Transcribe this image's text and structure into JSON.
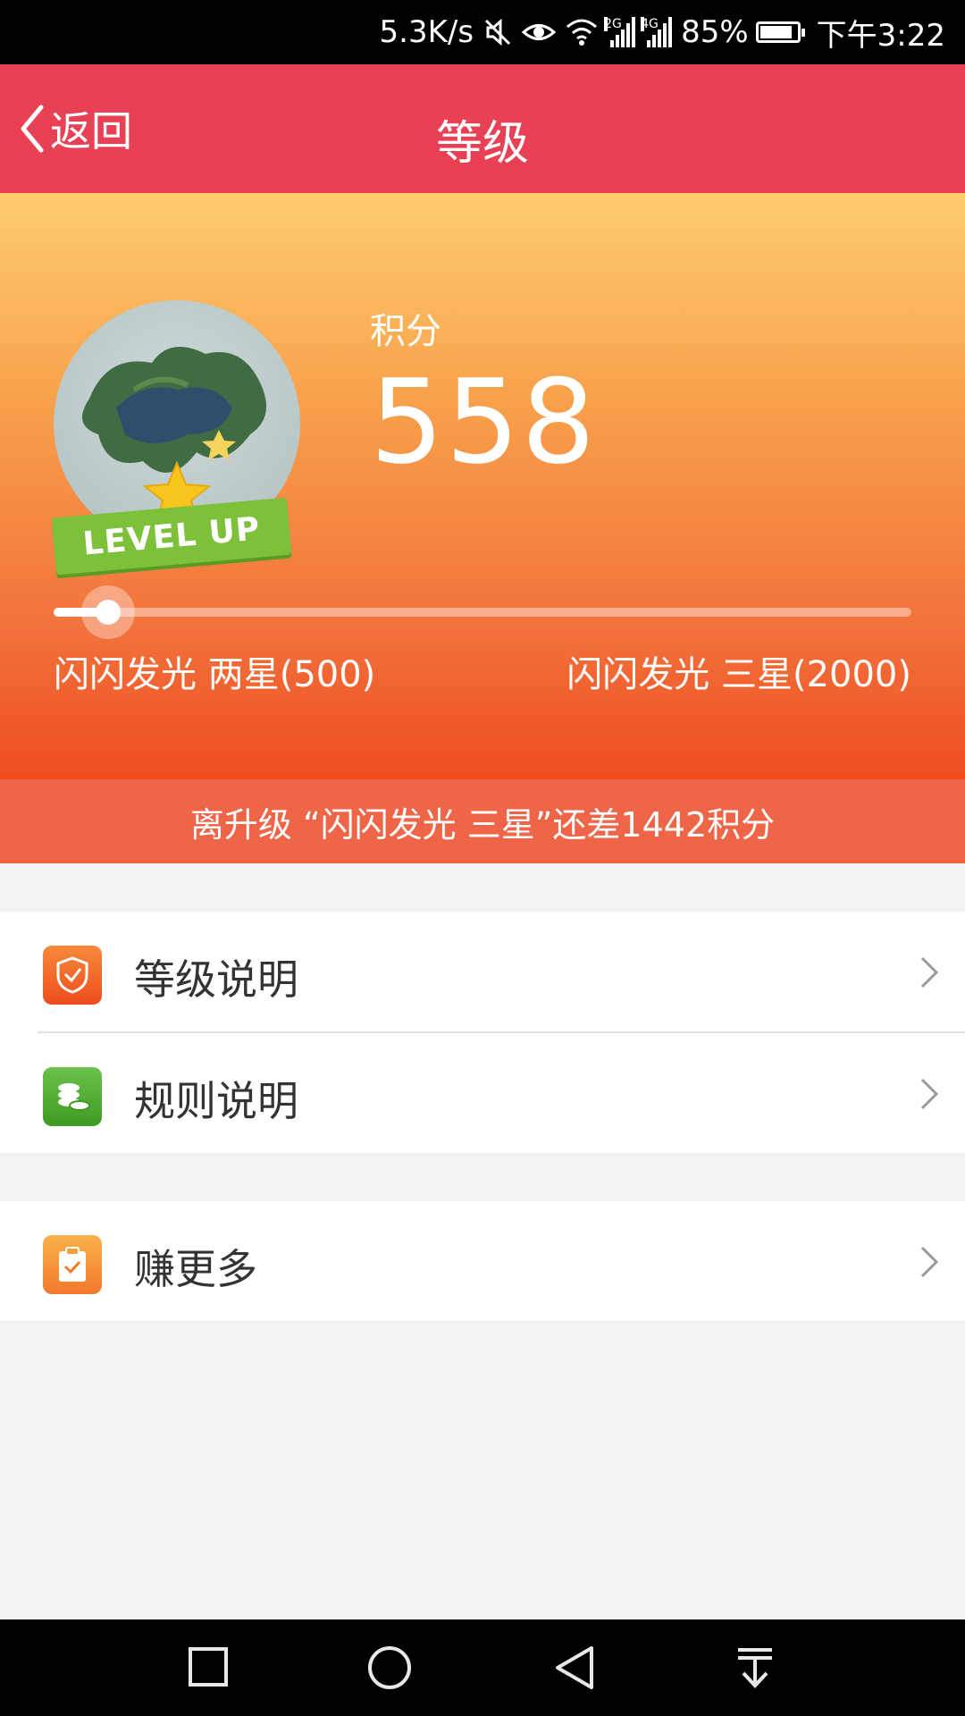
{
  "status_bar": {
    "speed": "5.3K/s",
    "sig1_tag": "2G",
    "sig2_tag": "4G",
    "battery": "85%",
    "time": "下午3:22",
    "icons": [
      "mute-icon",
      "eye-icon",
      "wifi-icon",
      "signal-icon",
      "battery-charging-icon"
    ]
  },
  "header": {
    "back_label": "返回",
    "title": "等级",
    "color": "#e84055"
  },
  "hero": {
    "points_label": "积分",
    "points_value": "558",
    "badge_text": "LEVEL UP",
    "current_level": "闪闪发光 两星(500)",
    "next_level": "闪闪发光 三星(2000)",
    "progress_fraction": 0.039
  },
  "notice": {
    "text": "离升级 “闪闪发光 三星”还差1442积分"
  },
  "menu": {
    "group1": [
      {
        "label": "等级说明",
        "icon": "shield-check-icon",
        "color": "#f0612e"
      },
      {
        "label": "规则说明",
        "icon": "coins-icon",
        "color": "#58b330"
      }
    ],
    "group2": [
      {
        "label": "赚更多",
        "icon": "clipboard-check-icon",
        "color": "#f6933a"
      }
    ]
  },
  "nav_bar": {
    "icons": [
      "recent-apps-icon",
      "home-icon",
      "back-icon",
      "notification-pull-icon"
    ]
  }
}
